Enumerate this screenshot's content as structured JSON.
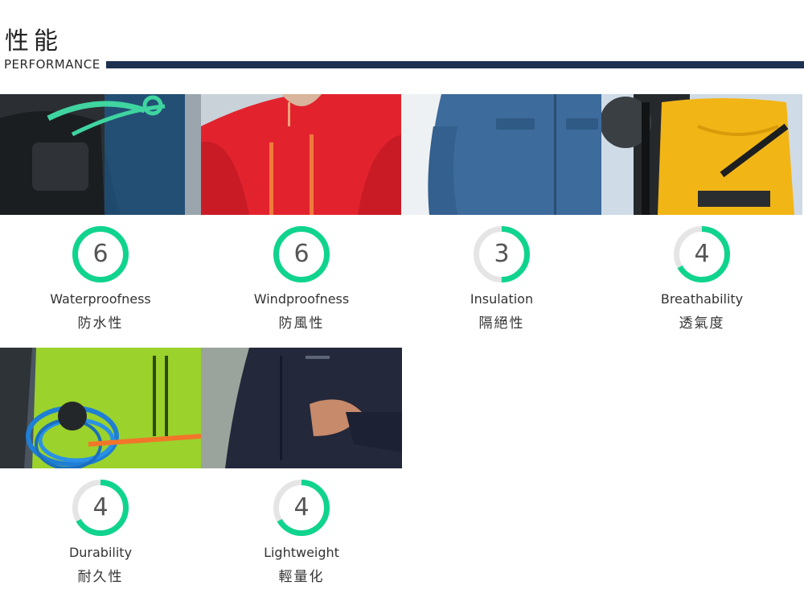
{
  "header": {
    "title_zh": "性能",
    "title_en": "PERFORMANCE",
    "accent_color": "#1e3250"
  },
  "rating": {
    "scale_max": 6,
    "fill_color": "#10d48e",
    "track_color": "#e5e5e5"
  },
  "features": [
    {
      "label_en": "Waterproofness",
      "label_zh": "防水性",
      "score": "6",
      "photo": "backpack-blue-jacket"
    },
    {
      "label_en": "Windproofness",
      "label_zh": "防風性",
      "score": "6",
      "photo": "red-jacket"
    },
    {
      "label_en": "Insulation",
      "label_zh": "隔絕性",
      "score": "3",
      "photo": "blue-insulated-jacket"
    },
    {
      "label_en": "Breathability",
      "label_zh": "透氣度",
      "score": "4",
      "photo": "yellow-jacket-helmet"
    },
    {
      "label_en": "Durability",
      "label_zh": "耐久性",
      "score": "4",
      "photo": "green-jacket-rope"
    },
    {
      "label_en": "Lightweight",
      "label_zh": "輕量化",
      "score": "4",
      "photo": "black-jacket-runner"
    }
  ]
}
